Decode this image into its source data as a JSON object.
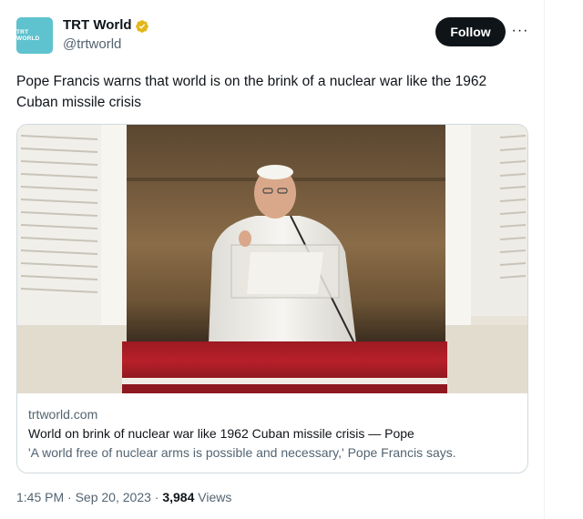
{
  "account": {
    "avatar_text": "TRT WORLD",
    "name": "TRT World",
    "handle": "@trtworld",
    "verified_icon": "gold-verified-badge-icon"
  },
  "actions": {
    "follow_label": "Follow",
    "more_icon": "more-options-icon",
    "more_glyph": "···"
  },
  "tweet": {
    "text": "Pope Francis warns that world is on the brink of a nuclear war like the 1962 Cuban missile crisis"
  },
  "card": {
    "domain": "trtworld.com",
    "title": "World on brink of nuclear war like 1962 Cuban missile crisis — Pope",
    "description": "'A world free of nuclear arms is possible and necessary,' Pope Francis says."
  },
  "meta": {
    "time": "1:45 PM",
    "date": "Sep 20, 2023",
    "separator": "·",
    "views_count": "3,984",
    "views_label": "Views"
  },
  "colors": {
    "avatar_bg": "#5fc2cf",
    "verified_gold": "#e2b719",
    "follow_bg": "#0f1419",
    "secondary_text": "#536471",
    "drape_red": "#b8202a"
  }
}
